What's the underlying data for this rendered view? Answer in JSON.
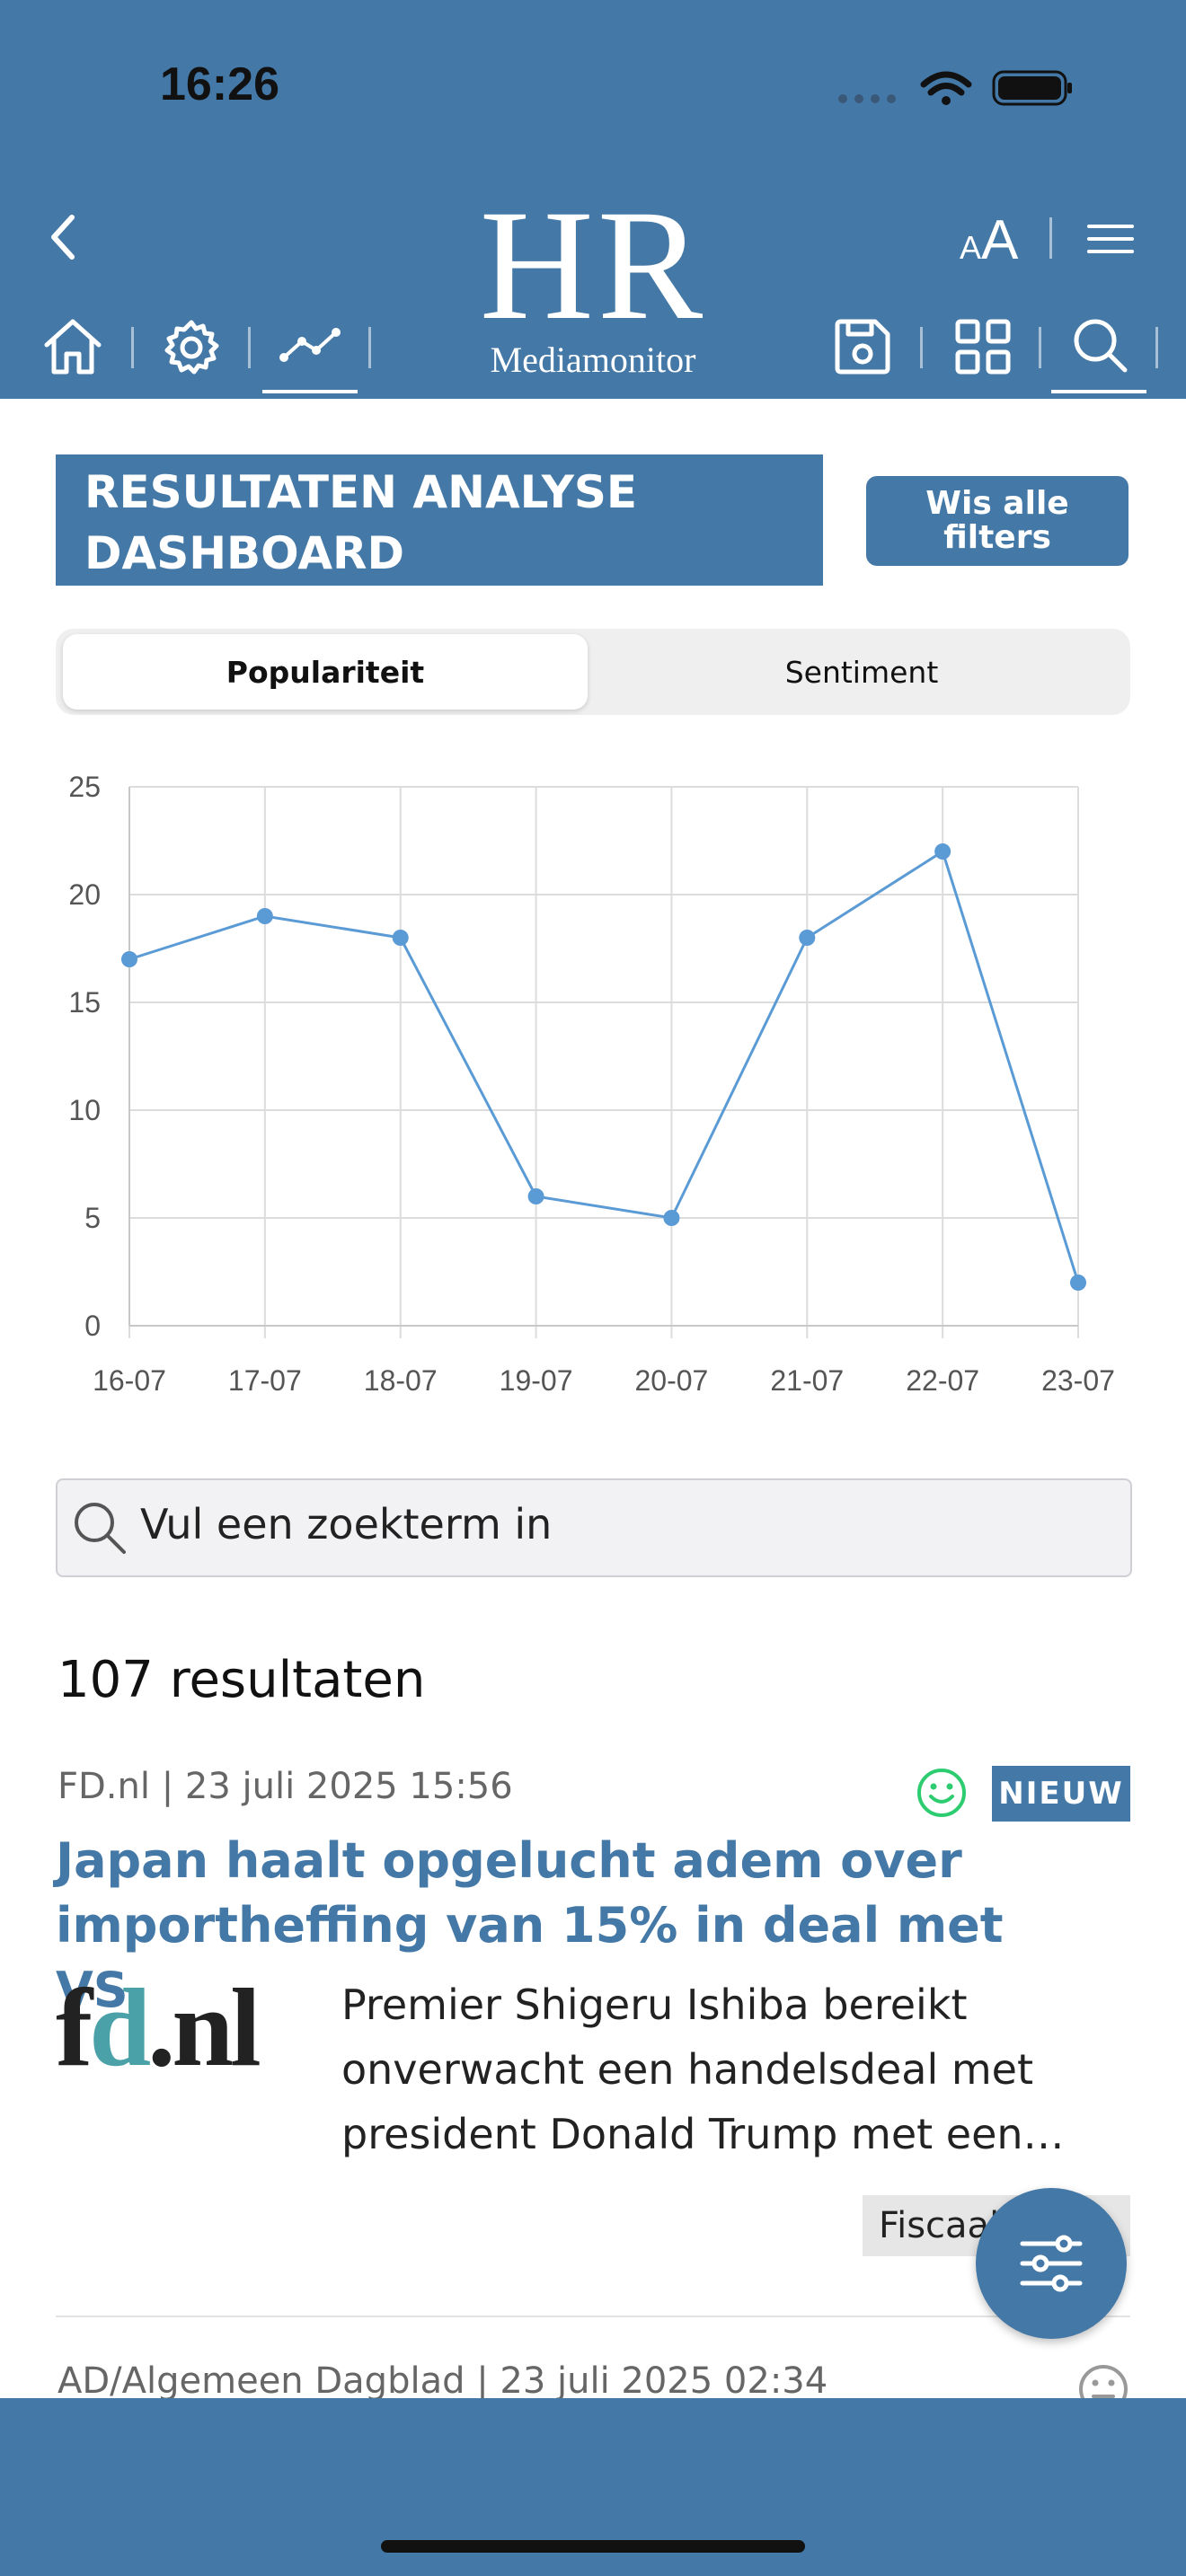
{
  "status_bar": {
    "time": "16:26"
  },
  "header": {
    "logo_main": "HR",
    "logo_sub": "Mediamonitor",
    "font_size_small": "A",
    "font_size_large": "A"
  },
  "page": {
    "title": "RESULTATEN ANALYSE DASHBOARD",
    "clear_filters_label": "Wis alle\nfilters"
  },
  "tabs": [
    {
      "label": "Populariteit",
      "selected": true
    },
    {
      "label": "Sentiment",
      "selected": false
    }
  ],
  "chart_data": {
    "type": "line",
    "x": [
      "16-07",
      "17-07",
      "18-07",
      "19-07",
      "20-07",
      "21-07",
      "22-07",
      "23-07"
    ],
    "series": [
      {
        "values": [
          17,
          19,
          18,
          6,
          5,
          18,
          22,
          2
        ]
      }
    ],
    "ylim": [
      0,
      25
    ],
    "yticks": [
      0,
      5,
      10,
      15,
      20,
      25
    ],
    "grid": true,
    "color": "#5b9bd5"
  },
  "search": {
    "placeholder": "Vul een zoekterm in"
  },
  "results": {
    "count_label": "107 resultaten"
  },
  "articles": [
    {
      "meta": "FD.nl | 23 juli 2025 15:56",
      "badge": "NIEUW",
      "sentiment": "positive",
      "title": "Japan haalt opgelucht adem over importheffing van 15% in deal met VS",
      "source_logo": "fd.nl",
      "description": "Premier Shigeru Ishiba bereikt onverwacht een handelsdeal met president Donald Trump met een…",
      "tag": "Fiscaal"
    },
    {
      "meta": "AD/Algemeen Dagblad | 23 juli 2025 02:34",
      "sentiment": "neutral"
    }
  ],
  "colors": {
    "brand": "#4478a6",
    "positive": "#2ecc71"
  }
}
